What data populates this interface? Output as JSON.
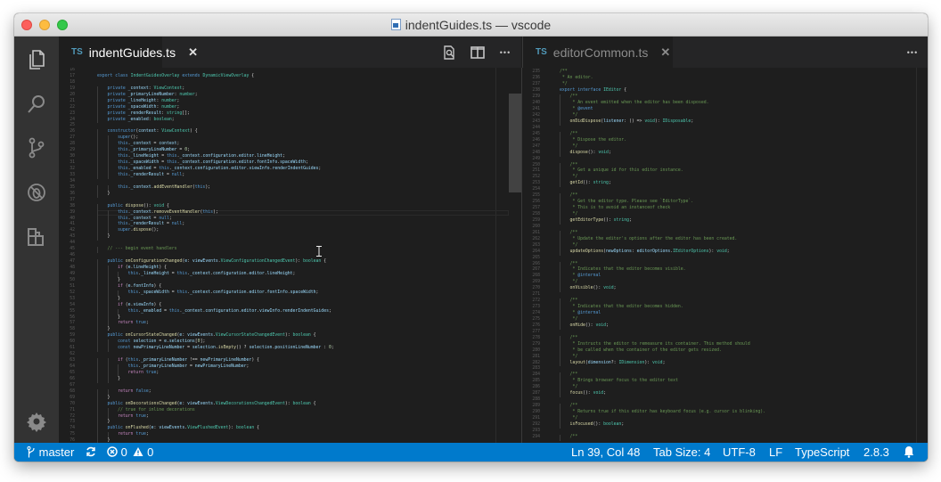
{
  "window": {
    "title": "indentGuides.ts — vscode"
  },
  "colors": {
    "status_bar": "#007acc",
    "activity_bar": "#333333",
    "editor_bg": "#1e1e1e",
    "ts_badge": "#519aba"
  },
  "activity_bar": {
    "items": [
      "files-icon",
      "search-icon",
      "source-control-icon",
      "debug-icon",
      "extensions-icon"
    ],
    "bottom": "gear-icon"
  },
  "left_group": {
    "tab": {
      "badge": "TS",
      "label": "indentGuides.ts",
      "close": "✕"
    },
    "toolbar": {
      "open_changes": "open-changes-icon",
      "split": "split-editor-icon",
      "more": "•••"
    }
  },
  "right_group": {
    "tab": {
      "badge": "TS",
      "label": "editorCommon.ts",
      "close": "✕"
    },
    "toolbar": {
      "more": "•••"
    }
  },
  "left_editor": {
    "first_line_number": 16,
    "current_line": 39,
    "lines": [
      "",
      "export class IndentGuidesOverlay extends DynamicViewOverlay {",
      "",
      "    private _context: ViewContext;",
      "    private _primaryLineNumber: number;",
      "    private _lineHeight: number;",
      "    private _spaceWidth: number;",
      "    private _renderResult: string[];",
      "    private _enabled: boolean;",
      "",
      "    constructor(context: ViewContext) {",
      "        super();",
      "        this._context = context;",
      "        this._primaryLineNumber = 0;",
      "        this._lineHeight = this._context.configuration.editor.lineHeight;",
      "        this._spaceWidth = this._context.configuration.editor.fontInfo.spaceWidth;",
      "        this._enabled = this._context.configuration.editor.viewInfo.renderIndentGuides;",
      "        this._renderResult = null;",
      "",
      "        this._context.addEventHandler(this);",
      "    }",
      "",
      "    public dispose(): void {",
      "        this._context.removeEventHandler(this);",
      "        this._context = null;",
      "        this._renderResult = null;",
      "        super.dispose();",
      "    }",
      "",
      "    // --- begin event handlers",
      "",
      "    public onConfigurationChanged(e: viewEvents.ViewConfigurationChangedEvent): boolean {",
      "        if (e.lineHeight) {",
      "            this._lineHeight = this._context.configuration.editor.lineHeight;",
      "        }",
      "        if (e.fontInfo) {",
      "            this._spaceWidth = this._context.configuration.editor.fontInfo.spaceWidth;",
      "        }",
      "        if (e.viewInfo) {",
      "            this._enabled = this._context.configuration.editor.viewInfo.renderIndentGuides;",
      "        }",
      "        return true;",
      "    }",
      "    public onCursorStateChanged(e: viewEvents.ViewCursorStateChangedEvent): boolean {",
      "        const selection = e.selections[0];",
      "        const newPrimaryLineNumber = selection.isEmpty() ? selection.positionLineNumber : 0;",
      "",
      "        if (this._primaryLineNumber !== newPrimaryLineNumber) {",
      "            this._primaryLineNumber = newPrimaryLineNumber;",
      "            return true;",
      "        }",
      "",
      "        return false;",
      "    }",
      "    public onDecorationsChanged(e: viewEvents.ViewDecorationsChangedEvent): boolean {",
      "        // true for inline decorations",
      "        return true;",
      "    }",
      "    public onFlushed(e: viewEvents.ViewFlushedEvent): boolean {",
      "        return true;",
      "    }"
    ]
  },
  "right_editor": {
    "first_line_number": 234,
    "lines": [
      "",
      "/**",
      " * An editor.",
      " */",
      "export interface IEditor {",
      "    /**",
      "     * An event emitted when the editor has been disposed.",
      "     * @event",
      "     */",
      "    onDidDispose(listener: () => void): IDisposable;",
      "",
      "    /**",
      "     * Dispose the editor.",
      "     */",
      "    dispose(): void;",
      "",
      "    /**",
      "     * Get a unique id for this editor instance.",
      "     */",
      "    getId(): string;",
      "",
      "    /**",
      "     * Get the editor type. Please see `EditorType`.",
      "     * This is to avoid an instanceof check",
      "     */",
      "    getEditorType(): string;",
      "",
      "    /**",
      "     * Update the editor's options after the editor has been created.",
      "     */",
      "    updateOptions(newOptions: editorOptions.IEditorOptions): void;",
      "",
      "    /**",
      "     * Indicates that the editor becomes visible.",
      "     * @internal",
      "     */",
      "    onVisible(): void;",
      "",
      "    /**",
      "     * Indicates that the editor becomes hidden.",
      "     * @internal",
      "     */",
      "    onHide(): void;",
      "",
      "    /**",
      "     * Instructs the editor to remeasure its container. This method should",
      "     * be called when the container of the editor gets resized.",
      "     */",
      "    layout(dimension?: IDimension): void;",
      "",
      "    /**",
      "     * Brings browser focus to the editor text",
      "     */",
      "    focus(): void;",
      "",
      "    /**",
      "     * Returns true if this editor has keyboard focus (e.g. cursor is blinking).",
      "     */",
      "    isFocused(): boolean;",
      "",
      "    /**"
    ]
  },
  "status_bar": {
    "branch": "master",
    "errors": "0",
    "warnings": "0",
    "cursor_position": "Ln 39, Col 48",
    "tab_size": "Tab Size: 4",
    "encoding": "UTF-8",
    "eol": "LF",
    "language": "TypeScript",
    "ts_version": "2.8.3"
  }
}
